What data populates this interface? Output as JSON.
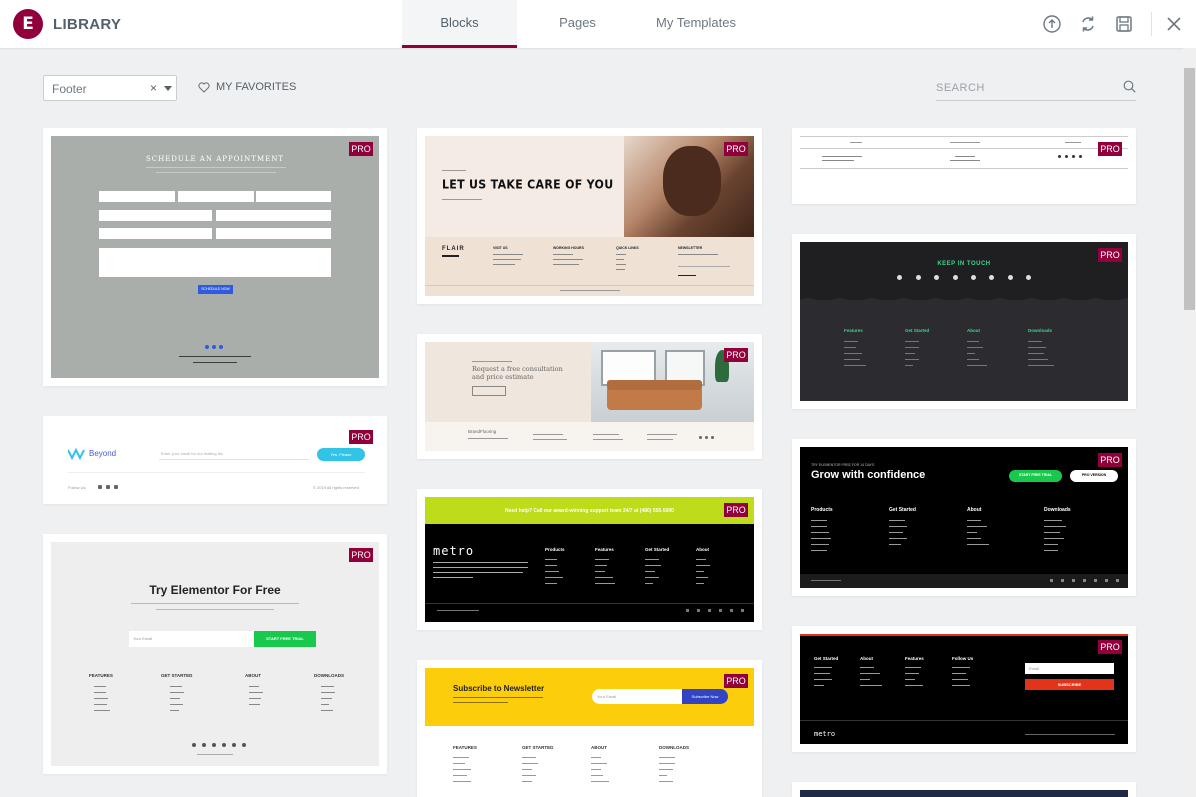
{
  "app": {
    "logo_letter": "E",
    "title": "LIBRARY",
    "brand_color": "#92003b"
  },
  "tabs": [
    {
      "label": "Blocks",
      "active": true
    },
    {
      "label": "Pages",
      "active": false
    },
    {
      "label": "My Templates",
      "active": false
    }
  ],
  "toolbar_icons": [
    "upload-icon",
    "sync-icon",
    "save-icon",
    "close-icon"
  ],
  "filter": {
    "selected": "Footer",
    "clear_symbol": "×"
  },
  "favorites_label": "MY FAVORITES",
  "search": {
    "placeholder": "SEARCH"
  },
  "badge": "PRO",
  "thumbnails": {
    "appointment": {
      "title": "SCHEDULE AN APPOINTMENT",
      "button": "SCHEDULE NOW"
    },
    "beyond": {
      "brand": "Beyond",
      "input_placeholder": "Enter your email for our mailing list",
      "button": "Yes, Please",
      "copy": "© 2019 All rights reserved",
      "follow": "Follow Us"
    },
    "elementor": {
      "title": "Try Elementor For Free",
      "text": "I am text block. Click edit button to change this text. Lorem ipsum dolor sit amet, consectetur adipiscing elit.",
      "input_placeholder": "Your Email",
      "button": "START FREE TRIAL",
      "cols": [
        "FEATURES",
        "GET STARTED",
        "ABOUT",
        "DOWNLOADS"
      ]
    },
    "care": {
      "title": "LET US TAKE CARE OF YOU",
      "brand": "FLAIR",
      "cols": [
        "VISIT US",
        "WORKING HOURS",
        "QUICK LINKS",
        "NEWSLETTER"
      ]
    },
    "consult": {
      "title_line1": "Request a free consultation",
      "title_line2": "and price estimate",
      "brand": "BrandFlooring"
    },
    "metro": {
      "banner": "Need help? Call our award-winning support team 24/7 at (480) 555-5000",
      "brand": "metro",
      "cols": [
        "Products",
        "Features",
        "Get Started",
        "About"
      ]
    },
    "newsletter": {
      "title": "Subscribe to Newsletter",
      "input_placeholder": "Your Email",
      "button": "Subscribe Now",
      "cols": [
        "FEATURES",
        "GET STARTED",
        "ABOUT",
        "DOWNLOADS"
      ]
    },
    "keep": {
      "title": "KEEP IN TOUCH",
      "cols": [
        "Features",
        "Get Started",
        "About",
        "Downloads"
      ]
    },
    "confidence": {
      "kicker": "TRY ELEMENTOR FREE FOR 14 DAYS",
      "title": "Grow with confidence",
      "btn1": "START FREE TRIAL",
      "btn2": "PRO VERSION",
      "cols": [
        "Products",
        "Get Started",
        "About",
        "Downloads"
      ]
    },
    "metro2": {
      "cols": [
        "Get Started",
        "About",
        "Features",
        "Follow Us"
      ],
      "input_placeholder": "Email",
      "button": "SUBSCRIBE",
      "brand": "metro"
    }
  }
}
